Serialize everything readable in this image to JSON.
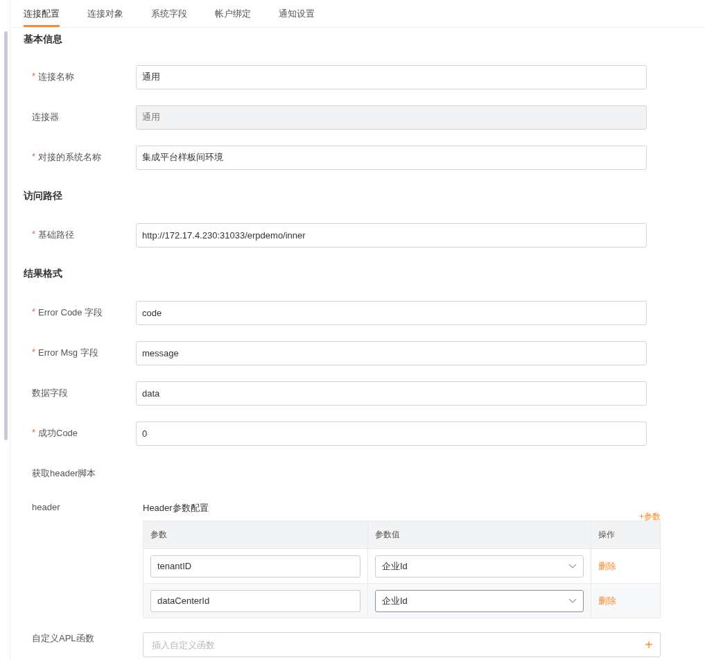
{
  "tabs": [
    {
      "label": "连接配置",
      "selected": true
    },
    {
      "label": "连接对象",
      "selected": false
    },
    {
      "label": "系统字段",
      "selected": false
    },
    {
      "label": "帐户绑定",
      "selected": false
    },
    {
      "label": "通知设置",
      "selected": false
    }
  ],
  "required_mark": "*",
  "sections": [
    {
      "title": "基本信息",
      "fields": [
        {
          "label": "连接名称",
          "required": true,
          "value": "通用",
          "disabled": false
        },
        {
          "label": "连接器",
          "required": false,
          "value": "通用",
          "disabled": true
        },
        {
          "label": "对接的系统名称",
          "required": true,
          "value": "集成平台样板间环境",
          "disabled": false
        }
      ]
    },
    {
      "title": "访问路径",
      "fields": [
        {
          "label": "基础路径",
          "required": true,
          "value": "http://172.17.4.230:31033/erpdemo/inner",
          "disabled": false
        }
      ]
    },
    {
      "title": "结果格式",
      "fields": [
        {
          "label": "Error Code 字段",
          "required": true,
          "value": "code",
          "disabled": false
        },
        {
          "label": "Error Msg 字段",
          "required": true,
          "value": "message",
          "disabled": false
        },
        {
          "label": "数据字段",
          "required": false,
          "value": "data",
          "disabled": false
        },
        {
          "label": "成功Code",
          "required": true,
          "value": "0",
          "disabled": false
        }
      ]
    }
  ],
  "script_label": "获取header脚本",
  "header": {
    "label": "header",
    "title": "Header参数配置",
    "add_link": "+参数",
    "columns": [
      "参数",
      "参数值",
      "操作"
    ],
    "rows": [
      {
        "param": "tenantID",
        "value": "企业Id",
        "action": "删除",
        "highlighted": false
      },
      {
        "param": "dataCenterId",
        "value": "企业Id",
        "action": "删除",
        "highlighted": true
      }
    ]
  },
  "apl": {
    "label": "自定义APL函数",
    "placeholder": "插入自定义函数",
    "add": "+"
  }
}
